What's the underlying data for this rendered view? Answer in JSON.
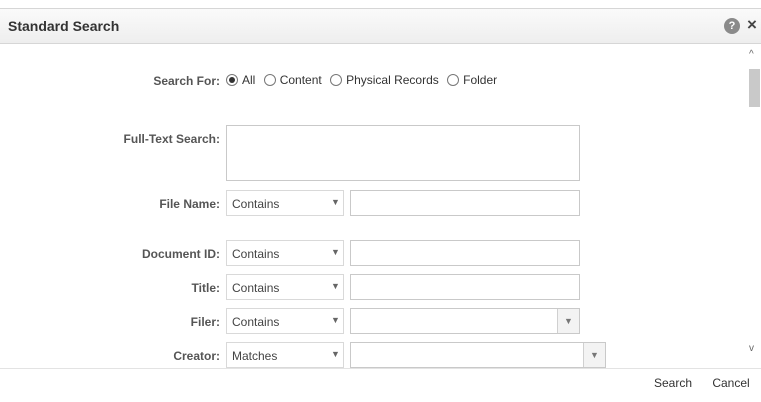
{
  "dialog": {
    "title": "Standard Search",
    "help_icon_glyph": "?",
    "close_icon_glyph": "×"
  },
  "search_for": {
    "label": "Search For:",
    "options": [
      "All",
      "Content",
      "Physical Records",
      "Folder"
    ],
    "selected": "All"
  },
  "full_text": {
    "label": "Full-Text Search:",
    "value": ""
  },
  "fields": [
    {
      "label": "File Name:",
      "operator": "Contains",
      "value": ""
    },
    {
      "label": "Document ID:",
      "operator": "Contains",
      "value": ""
    },
    {
      "label": "Title:",
      "operator": "Contains",
      "value": ""
    },
    {
      "label": "Filer:",
      "operator": "Contains",
      "value": ""
    },
    {
      "label": "Creator:",
      "operator": "Matches",
      "value": ""
    }
  ],
  "buttons": {
    "search": "Search",
    "cancel": "Cancel"
  },
  "icons": {
    "dropdown": "chevron-down-icon",
    "help": "help-icon",
    "close": "close-icon"
  }
}
